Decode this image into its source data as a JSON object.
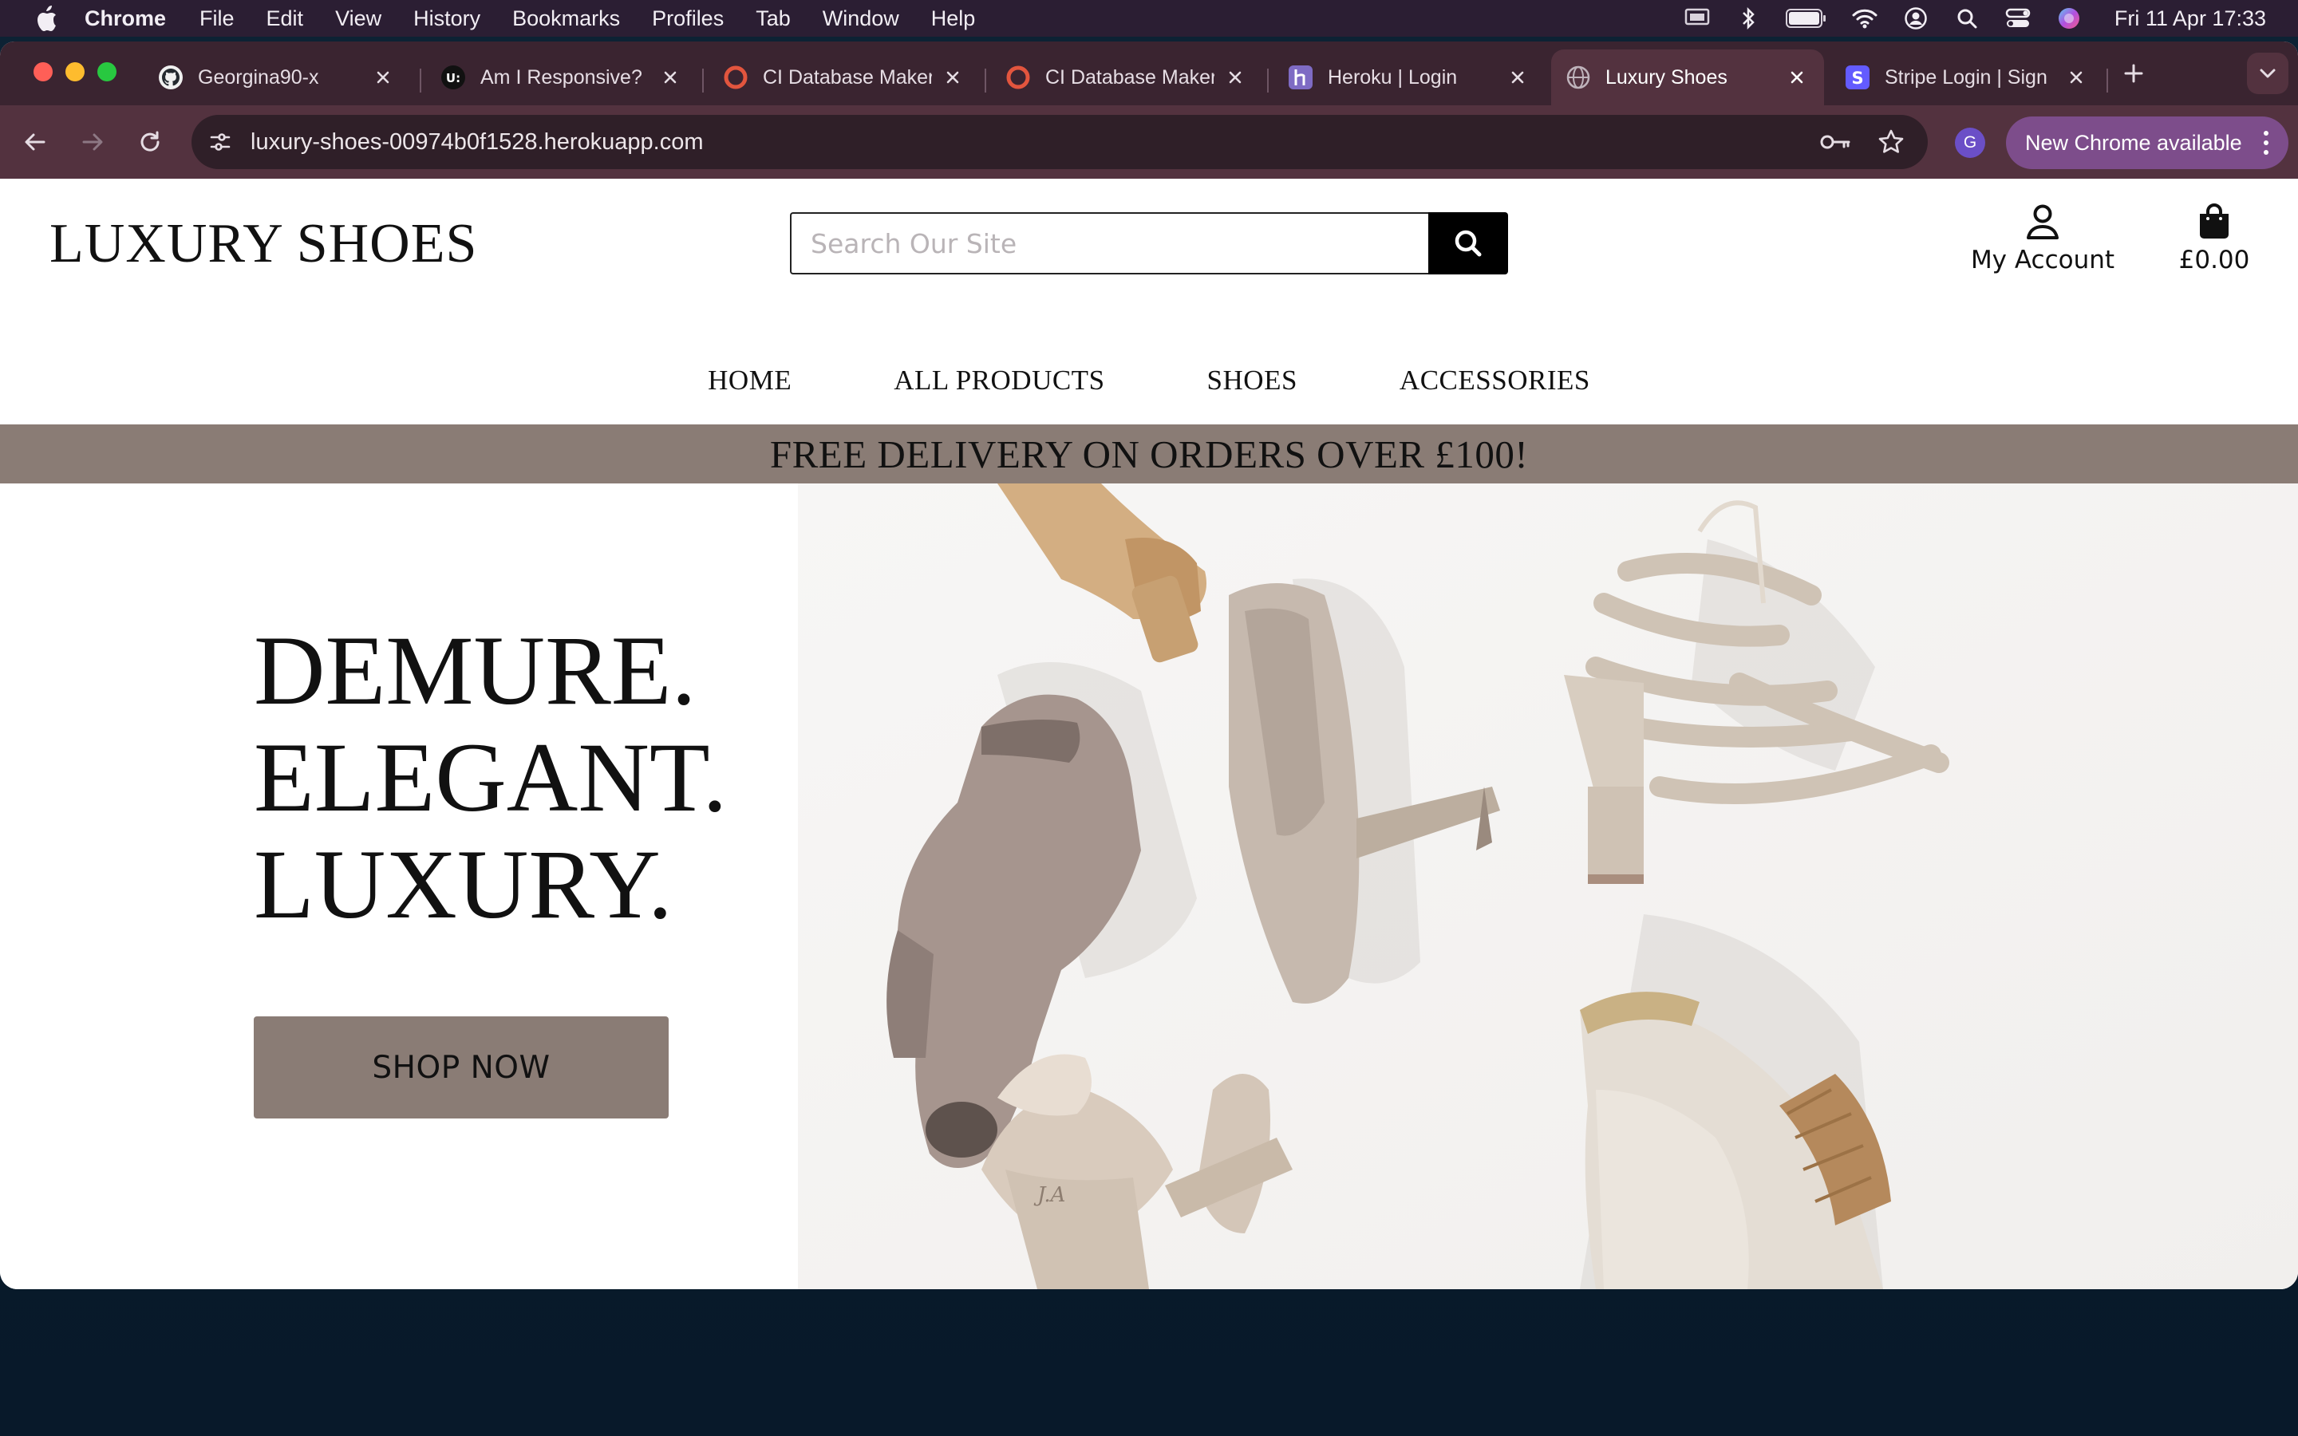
{
  "menubar": {
    "app_name": "Chrome",
    "menus": [
      "File",
      "Edit",
      "View",
      "History",
      "Bookmarks",
      "Profiles",
      "Tab",
      "Window",
      "Help"
    ],
    "clock": "Fri 11 Apr  17:33",
    "status_icons": [
      "screen-mirroring-icon",
      "bluetooth-icon",
      "battery-icon",
      "wifi-icon",
      "user-icon",
      "spotlight-search-icon",
      "control-center-icon",
      "siri-icon"
    ]
  },
  "browser": {
    "tabs": [
      {
        "title": "Georgina90-x",
        "icon": "github-icon"
      },
      {
        "title": "Am I Responsive?",
        "icon": "am-i-responsive-icon"
      },
      {
        "title": "CI Database Maker",
        "icon": "ci-database-icon"
      },
      {
        "title": "CI Database Maker",
        "icon": "ci-database-icon"
      },
      {
        "title": "Heroku | Login",
        "icon": "heroku-icon"
      },
      {
        "title": "Luxury Shoes",
        "icon": "globe-icon",
        "active": true
      },
      {
        "title": "Stripe Login | Sign",
        "icon": "stripe-icon"
      }
    ],
    "url": "luxury-shoes-00974b0f1528.herokuapp.com",
    "profile_initial": "G",
    "update_label": "New Chrome available",
    "accent_color": "#53323f"
  },
  "site": {
    "brand": "LUXURY SHOES",
    "search": {
      "placeholder": "Search Our Site",
      "value": ""
    },
    "account_label": "My Account",
    "bag_total": "£0.00",
    "nav": [
      "HOME",
      "ALL PRODUCTS",
      "SHOES",
      "ACCESSORIES"
    ],
    "banner": "FREE DELIVERY ON ORDERS OVER £100!",
    "banner_color": "#8a7c75",
    "hero": {
      "lines": [
        "DEMURE.",
        "ELEGANT.",
        "LUXURY."
      ],
      "cta": "SHOP NOW"
    }
  }
}
